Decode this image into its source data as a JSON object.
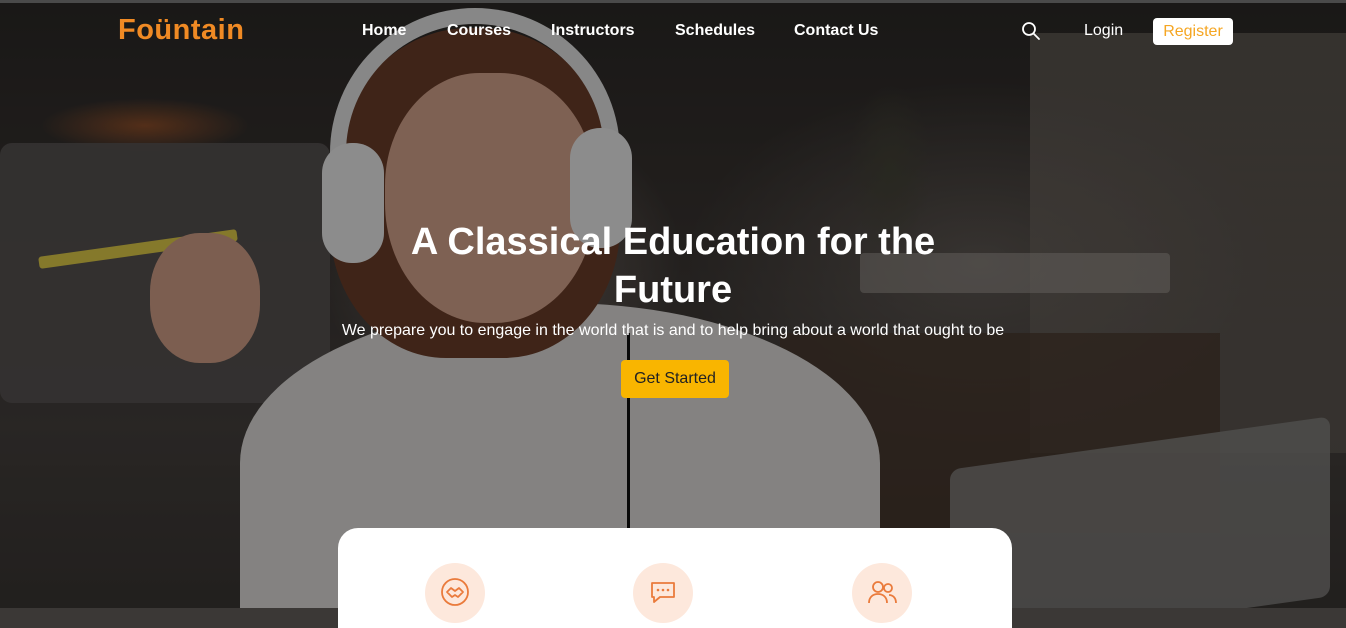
{
  "brand": {
    "name": "Foüntain",
    "color": "#f08a24"
  },
  "nav": {
    "items": [
      {
        "label": "Home"
      },
      {
        "label": "Courses"
      },
      {
        "label": "Instructors"
      },
      {
        "label": "Schedules"
      },
      {
        "label": "Contact Us"
      }
    ],
    "search_icon": "search-icon",
    "login_label": "Login",
    "register_label": "Register"
  },
  "hero": {
    "title_line1": "A Classical Education for the",
    "title_line2": "Future",
    "subtitle": "We prepare you to engage in the world that is and to help bring about a world that ought to be",
    "cta_label": "Get Started",
    "cta_color": "#f9b500"
  },
  "features": {
    "icons": [
      "handshake-icon",
      "chat-bubble-icon",
      "users-icon"
    ],
    "icon_bg": "#fde8dc",
    "icon_color": "#ea7b3c"
  }
}
